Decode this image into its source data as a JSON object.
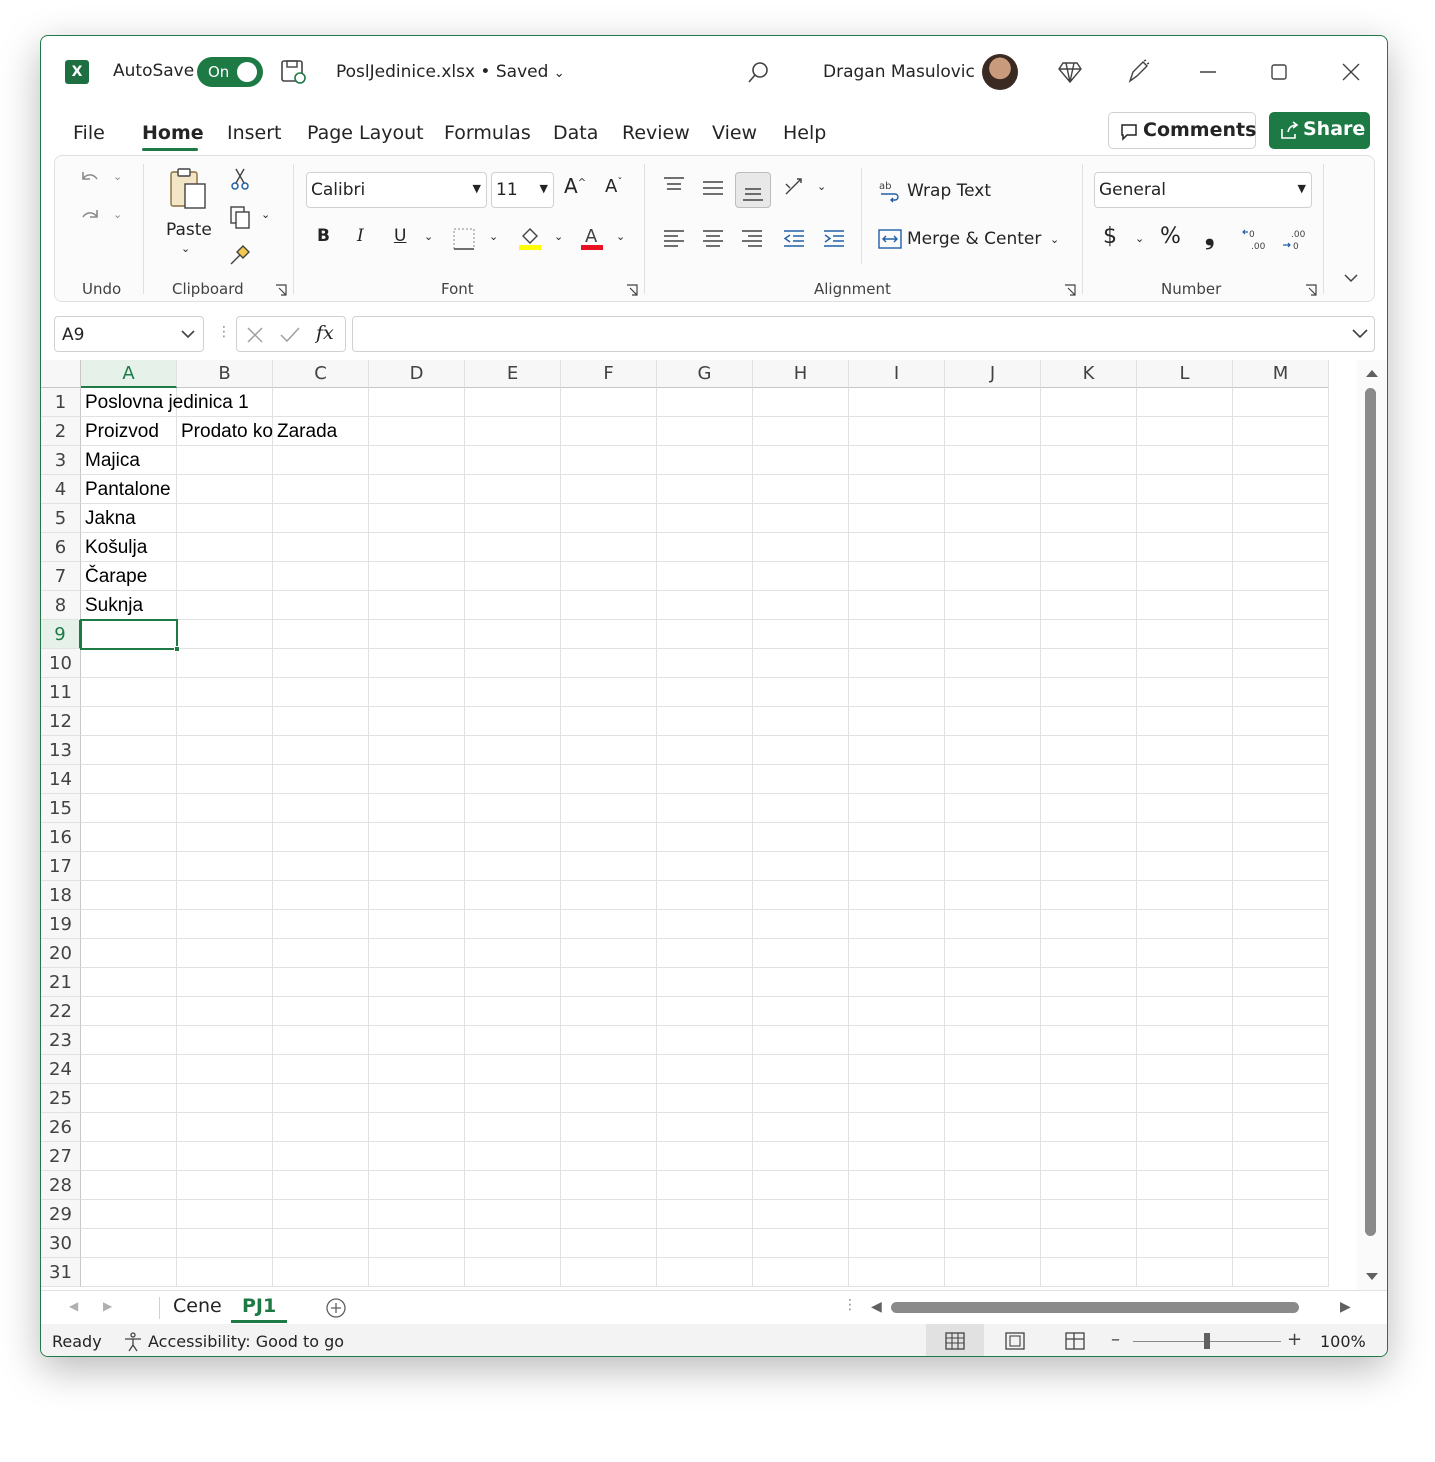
{
  "titlebar": {
    "app_icon": "excel-logo",
    "app_letter": "X",
    "autosave_label": "AutoSave",
    "autosave_state": "On",
    "filename": "PoslJedinice.xlsx • Saved",
    "username": "Dragan Masulovic"
  },
  "menu": {
    "items": [
      "File",
      "Home",
      "Insert",
      "Page Layout",
      "Formulas",
      "Data",
      "Review",
      "View",
      "Help"
    ],
    "active": "Home",
    "comments_label": "Comments",
    "share_label": "Share"
  },
  "ribbon": {
    "groups": {
      "undo": "Undo",
      "clipboard": "Clipboard",
      "font": "Font",
      "alignment": "Alignment",
      "number": "Number"
    },
    "paste_label": "Paste",
    "font_name": "Calibri",
    "font_size": "11",
    "bold": "B",
    "italic": "I",
    "underline": "U",
    "wrap_text": "Wrap Text",
    "merge_center": "Merge & Center",
    "number_format": "General",
    "currency": "$",
    "percent": "%",
    "comma": "❟"
  },
  "formula_bar": {
    "name_box": "A9",
    "formula": "",
    "fx": "fx"
  },
  "sheet": {
    "columns": [
      "A",
      "B",
      "C",
      "D",
      "E",
      "F",
      "G",
      "H",
      "I",
      "J",
      "K",
      "L",
      "M"
    ],
    "selected_column": "A",
    "rows": [
      "1",
      "2",
      "3",
      "4",
      "5",
      "6",
      "7",
      "8",
      "9",
      "10",
      "11",
      "12",
      "13",
      "14",
      "15",
      "16",
      "17",
      "18",
      "19",
      "20",
      "21",
      "22",
      "23",
      "24",
      "25",
      "26",
      "27",
      "28",
      "29",
      "30",
      "31"
    ],
    "selected_row": "9",
    "cells": {
      "A1": "Poslovna jedinica 1",
      "A2": "Proizvod",
      "B2": "Prodato komada",
      "C2": "Zarada",
      "A3": "Majica",
      "A4": "Pantalone",
      "A5": "Jakna",
      "A6": "Košulja",
      "A7": "Čarape",
      "A8": "Suknja"
    },
    "selected_cell": "A9"
  },
  "sheet_tabs": {
    "tabs": [
      "Cene",
      "PJ1"
    ],
    "active": "PJ1"
  },
  "status": {
    "ready": "Ready",
    "accessibility": "Accessibility: Good to go",
    "zoom": "100%",
    "zoom_level": 0.5
  },
  "colors": {
    "accent": "#1e7a45",
    "selection": "#1e7a45"
  }
}
